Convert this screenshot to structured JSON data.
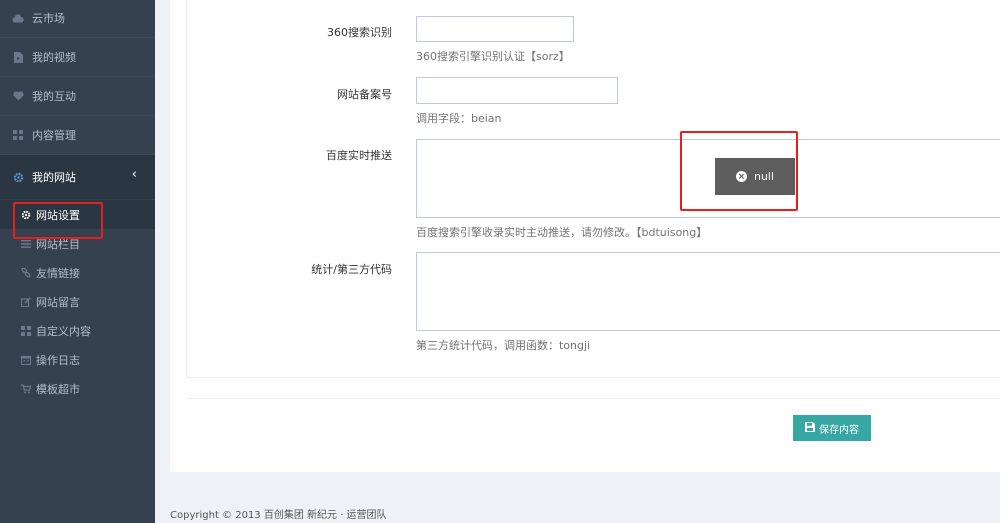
{
  "sidebar": {
    "items": [
      {
        "label": "云市场",
        "icon": "cloud-icon"
      },
      {
        "label": "我的视频",
        "icon": "file-video-icon"
      },
      {
        "label": "我的互动",
        "icon": "heart-icon"
      },
      {
        "label": "内容管理",
        "icon": "grid-icon"
      },
      {
        "label": "我的网站",
        "icon": "gear-icon"
      }
    ],
    "chevron": "‹",
    "sub_items": [
      {
        "label": "网站设置",
        "icon": "gear-icon"
      },
      {
        "label": "网站栏目",
        "icon": "list-icon"
      },
      {
        "label": "友情链接",
        "icon": "link-icon"
      },
      {
        "label": "网站留言",
        "icon": "edit-icon"
      },
      {
        "label": "自定义内容",
        "icon": "grid-icon"
      },
      {
        "label": "操作日志",
        "icon": "calendar-icon"
      },
      {
        "label": "模板超市",
        "icon": "cart-icon"
      }
    ]
  },
  "form": {
    "fields": [
      {
        "label": "360搜索识别",
        "value": "",
        "help": "360搜索引擎识别认证【sorz】"
      },
      {
        "label": "网站备案号",
        "value": "",
        "help": "调用字段：beian"
      },
      {
        "label": "百度实时推送",
        "value": "",
        "help": "百度搜索引擎收录实时主动推送，请勿修改。【bdtuisong】"
      },
      {
        "label": "统计/第三方代码",
        "value": "",
        "help": "第三方统计代码，调用函数：tongji"
      }
    ]
  },
  "toast": {
    "text": "null",
    "icon": "close-circle-icon"
  },
  "save_button": {
    "label": "保存内容",
    "icon": "save-icon"
  },
  "footer": {
    "copyright": "Copyright © 2013 百创集团 新纪元 · 运营团队"
  },
  "colors": {
    "sidebar_bg": "#364150",
    "active_bg": "#2b3643",
    "accent": "#36a7a3",
    "highlight": "#e51e1e"
  }
}
